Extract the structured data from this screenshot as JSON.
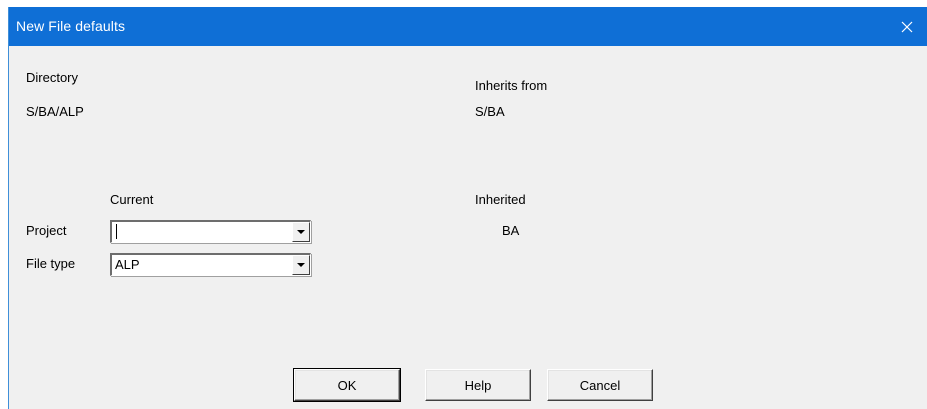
{
  "window": {
    "title": "New File defaults",
    "close_icon": "close-icon"
  },
  "info": {
    "directory_label": "Directory",
    "directory_value": "S/BA/ALP",
    "inherits_from_label": "Inherits from",
    "inherits_from_value": "S/BA"
  },
  "columns": {
    "current_label": "Current",
    "inherited_label": "Inherited"
  },
  "fields": {
    "project": {
      "label": "Project",
      "value": "",
      "inherited": "BA"
    },
    "file_type": {
      "label": "File type",
      "value": "ALP",
      "inherited": ""
    }
  },
  "buttons": {
    "ok": "OK",
    "help": "Help",
    "cancel": "Cancel"
  },
  "colors": {
    "titlebar": "#0f6fd6",
    "dialog_bg": "#f0f0f0"
  }
}
